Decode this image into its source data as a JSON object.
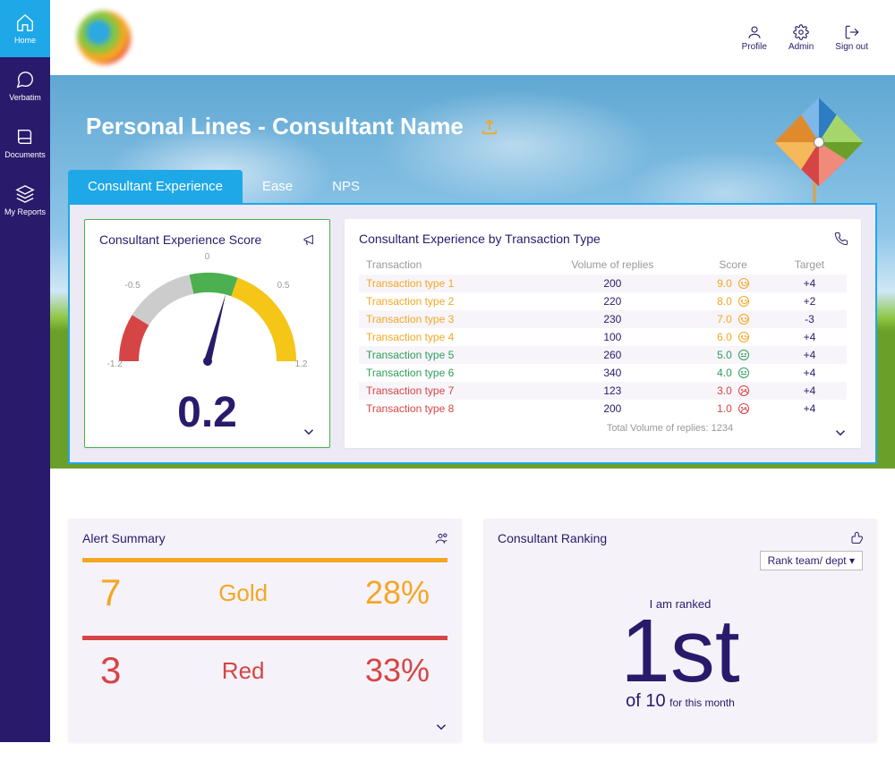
{
  "sidebar": {
    "items": [
      {
        "label": "Home"
      },
      {
        "label": "Verbatim"
      },
      {
        "label": "Documents"
      },
      {
        "label": "My Reports"
      }
    ]
  },
  "topbar": {
    "profile": "Profile",
    "admin": "Admin",
    "signout": "Sign out"
  },
  "header": {
    "title": "Personal Lines - Consultant Name"
  },
  "tabs": [
    {
      "label": "Consultant Experience"
    },
    {
      "label": "Ease"
    },
    {
      "label": "NPS"
    }
  ],
  "gauge": {
    "title": "Consultant Experience Score",
    "value": "0.2",
    "ticks": {
      "top": "0",
      "l1": "-0.5",
      "r1": "0.5",
      "l2": "-1.2",
      "r2": "1.2"
    }
  },
  "transactions": {
    "title": "Consultant Experience by Transaction Type",
    "columns": [
      "Transaction",
      "Volume of replies",
      "Score",
      "Target"
    ],
    "rows": [
      {
        "name": "Transaction type 1",
        "vol": "200",
        "score": "9.0",
        "target": "+4",
        "color": "gold",
        "face": "smile"
      },
      {
        "name": "Transaction type 2",
        "vol": "220",
        "score": "8.0",
        "target": "+2",
        "color": "gold",
        "face": "smile"
      },
      {
        "name": "Transaction type 3",
        "vol": "230",
        "score": "7.0",
        "target": "-3",
        "color": "gold",
        "face": "smile"
      },
      {
        "name": "Transaction type 4",
        "vol": "100",
        "score": "6.0",
        "target": "+4",
        "color": "gold",
        "face": "smile"
      },
      {
        "name": "Transaction type 5",
        "vol": "260",
        "score": "5.0",
        "target": "+4",
        "color": "green",
        "face": "neutral"
      },
      {
        "name": "Transaction type 6",
        "vol": "340",
        "score": "4.0",
        "target": "+4",
        "color": "green",
        "face": "neutral"
      },
      {
        "name": "Transaction type 7",
        "vol": "123",
        "score": "3.0",
        "target": "+4",
        "color": "red",
        "face": "sad"
      },
      {
        "name": "Transaction type 8",
        "vol": "200",
        "score": "1.0",
        "target": "+4",
        "color": "red",
        "face": "sad"
      }
    ],
    "total_label": "Total Volume of replies: 1234"
  },
  "alerts": {
    "title": "Alert Summary",
    "rows": [
      {
        "num": "7",
        "label": "Gold",
        "pct": "28%",
        "cls": "gold"
      },
      {
        "num": "3",
        "label": "Red",
        "pct": "33%",
        "cls": "red"
      }
    ]
  },
  "ranking": {
    "title": "Consultant Ranking",
    "dropdown": "Rank team/ dept",
    "lead": "I am ranked",
    "rank": "1st",
    "of": "of 10",
    "period": "for this month"
  },
  "chart_data": {
    "type": "gauge",
    "title": "Consultant Experience Score",
    "value": 0.2,
    "min": -1.2,
    "max": 1.2,
    "ticks": [
      -1.2,
      -0.5,
      0,
      0.5,
      1.2
    ],
    "segments": [
      {
        "from": -1.2,
        "to": -0.7,
        "color": "#d64545"
      },
      {
        "from": -0.7,
        "to": -0.15,
        "color": "#cccccc"
      },
      {
        "from": -0.15,
        "to": 0.25,
        "color": "#4caf50"
      },
      {
        "from": 0.25,
        "to": 1.2,
        "color": "#f5c518"
      }
    ]
  }
}
